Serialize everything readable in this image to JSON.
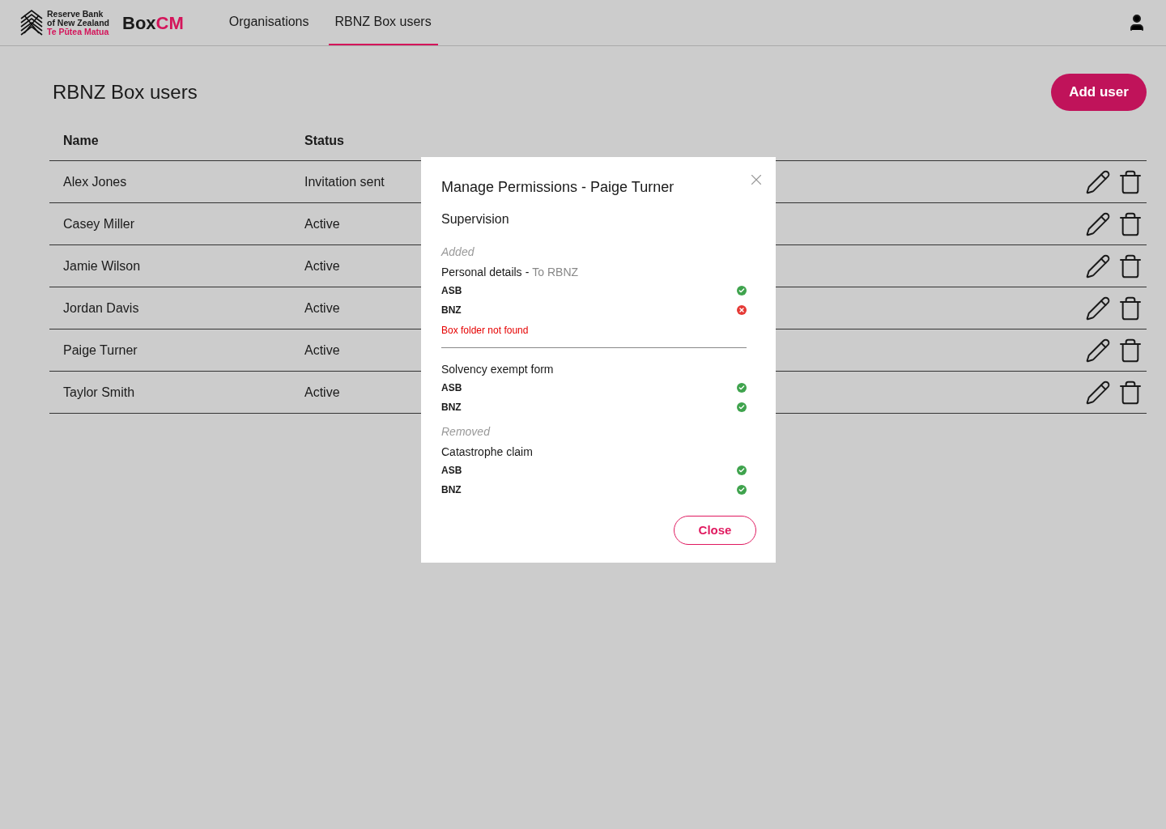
{
  "logo": {
    "line_1": "Reserve Bank",
    "line_2": "of New Zealand",
    "line_3": "Te Pūtea Matua"
  },
  "brand": {
    "part_1": "Box",
    "part_2": "CM"
  },
  "nav": [
    {
      "label": "Organisations",
      "selected": false
    },
    {
      "label": "RBNZ Box users",
      "selected": true
    }
  ],
  "page_title": "RBNZ Box users",
  "add_button": "Add user",
  "table": {
    "columns": [
      "Name",
      "Status"
    ],
    "rows": [
      {
        "name": "Alex Jones",
        "status": "Invitation sent"
      },
      {
        "name": "Casey Miller",
        "status": "Active"
      },
      {
        "name": "Jamie Wilson",
        "status": "Active"
      },
      {
        "name": "Jordan Davis",
        "status": "Active"
      },
      {
        "name": "Paige Turner",
        "status": "Active"
      },
      {
        "name": "Taylor Smith",
        "status": "Active"
      }
    ]
  },
  "dialog": {
    "title_prefix": "Manage Permissions -",
    "title_name": "Paige Turner",
    "section": "Supervision",
    "groups": [
      {
        "label": "Added",
        "items": [
          {
            "title": "Personal details",
            "separator": "-",
            "detail": "To RBNZ",
            "banks": [
              {
                "name": "ASB",
                "kind": "ok"
              },
              {
                "name": "BNZ",
                "kind": "error"
              }
            ],
            "message": "Box folder not found"
          },
          {
            "title": "Solvency exempt form",
            "banks": [
              {
                "name": "ASB",
                "kind": "ok"
              },
              {
                "name": "BNZ",
                "kind": "ok"
              }
            ]
          }
        ]
      },
      {
        "label": "Removed",
        "items": [
          {
            "title": "Catastrophe claim",
            "banks": [
              {
                "name": "ASB",
                "kind": "ok"
              },
              {
                "name": "BNZ",
                "kind": "ok"
              }
            ]
          }
        ]
      }
    ],
    "close_button": "Close"
  }
}
